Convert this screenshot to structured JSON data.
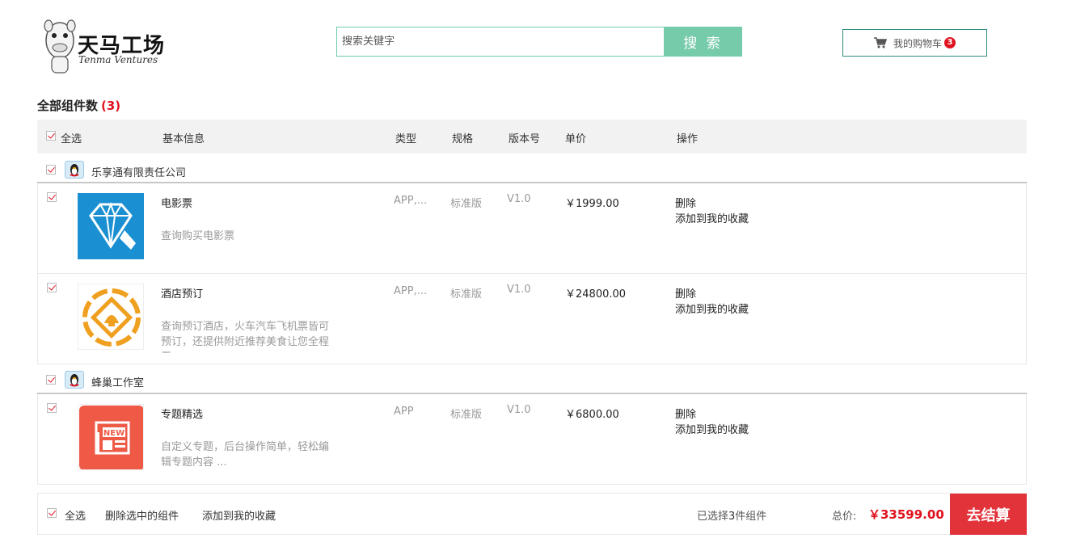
{
  "header": {
    "logo_cn": "天马工场",
    "logo_en": "Tenma Ventures",
    "search_placeholder": "搜索关键字",
    "search_button": "搜 索",
    "cart_label": "我的购物车",
    "cart_count": "3"
  },
  "section": {
    "title": "全部组件数",
    "count": "(3)"
  },
  "table_head": {
    "select_all": "全选",
    "basic_info": "基本信息",
    "type": "类型",
    "spec": "规格",
    "version": "版本号",
    "unit_price": "单价",
    "operation": "操作"
  },
  "shops": [
    {
      "name": "乐享通有限责任公司",
      "items": [
        {
          "name": "电影票",
          "desc": "查询购买电影票",
          "type": "APP,...",
          "spec": "标准版",
          "version": "V1.0",
          "price": "￥1999.00",
          "delete": "删除",
          "favorite": "添加到我的收藏",
          "icon": "diamond-film-icon"
        },
        {
          "name": "酒店预订",
          "desc": "查询预订酒店，火车汽车飞机票皆可预订，还提供附近推荐美食让您全程无",
          "type": "APP,...",
          "spec": "标准版",
          "version": "V1.0",
          "price": "￥24800.00",
          "delete": "删除",
          "favorite": "添加到我的收藏",
          "icon": "shell-emblem-icon"
        }
      ]
    },
    {
      "name": "蜂巢工作室",
      "items": [
        {
          "name": "专题精选",
          "desc": "自定义专题，后台操作简单，轻松编辑专题内容 ...",
          "type": "APP",
          "spec": "标准版",
          "version": "V1.0",
          "price": "￥6800.00",
          "delete": "删除",
          "favorite": "添加到我的收藏",
          "icon": "news-icon"
        }
      ]
    }
  ],
  "footer": {
    "select_all": "全选",
    "delete_selected": "删除选中的组件",
    "add_favorites": "添加到我的收藏",
    "chosen_prefix": "已选择",
    "chosen_count": "3",
    "chosen_suffix": "件组件",
    "total_label": "总价:",
    "total_value": "￥33599.00",
    "checkout": "去结算"
  },
  "colors": {
    "accent_green": "#76cbab",
    "accent_red": "#e2333b",
    "badge_red": "#e0121f"
  }
}
